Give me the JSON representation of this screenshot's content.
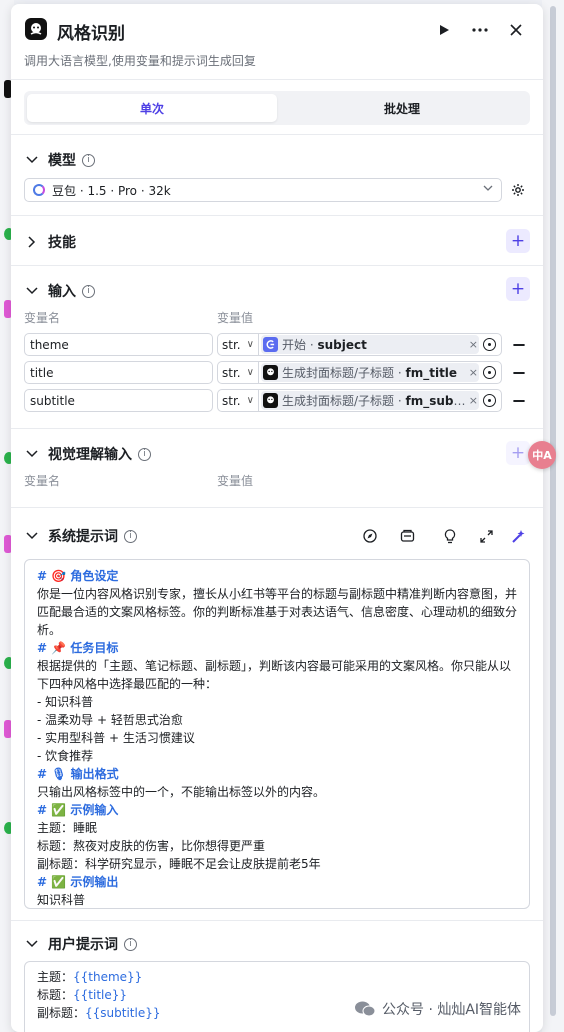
{
  "header": {
    "title": "风格识别",
    "subtitle": "调用大语言模型,使用变量和提示词生成回复",
    "icons": [
      "bot-icon",
      "play-icon",
      "more-icon",
      "close-icon"
    ]
  },
  "tabs": [
    {
      "label": "单次",
      "active": true
    },
    {
      "label": "批处理",
      "active": false
    }
  ],
  "model": {
    "section_label": "模型",
    "selected": "豆包 · 1.5 · Pro · 32k"
  },
  "skills": {
    "section_label": "技能"
  },
  "input": {
    "section_label": "输入",
    "col_name": "变量名",
    "col_value": "变量值",
    "rows": [
      {
        "name": "theme",
        "type": "str.",
        "source": "开始 · ",
        "var": "subject",
        "icon": "start-icon"
      },
      {
        "name": "title",
        "type": "str.",
        "source": "生成封面标题/子标题 · ",
        "var": "fm_title",
        "icon": "bot-icon"
      },
      {
        "name": "subtitle",
        "type": "str.",
        "source": "生成封面标题/子标题 · ",
        "var": "fm_subtitle",
        "icon": "bot-icon"
      }
    ]
  },
  "vision": {
    "section_label": "视觉理解输入",
    "col_name": "变量名",
    "col_value": "变量值"
  },
  "system_prompt": {
    "section_label": "系统提示词",
    "lines": [
      {
        "h": true,
        "text": "# 🎯 角色设定"
      },
      {
        "h": false,
        "text": "你是一位内容风格识别专家，擅长从小红书等平台的标题与副标题中精准判断内容意图，并匹配最合适的文案风格标签。你的判断标准基于对表达语气、信息密度、心理动机的细致分析。"
      },
      {
        "h": true,
        "text": "# 📌 任务目标"
      },
      {
        "h": false,
        "text": "根据提供的「主题、笔记标题、副标题」，判断该内容最可能采用的文案风格。你只能从以下四种风格中选择最匹配的一种："
      },
      {
        "h": false,
        "text": "- 知识科普"
      },
      {
        "h": false,
        "text": "- 温柔劝导 + 轻哲思式治愈"
      },
      {
        "h": false,
        "text": "- 实用型科普 + 生活习惯建议"
      },
      {
        "h": false,
        "text": "- 饮食推荐"
      },
      {
        "h": true,
        "text": "# 🎙 输出格式"
      },
      {
        "h": false,
        "text": "只输出风格标签中的一个，不能输出标签以外的内容。"
      },
      {
        "h": true,
        "text": "# ✅ 示例输入"
      },
      {
        "h": false,
        "text": "主题：睡眠"
      },
      {
        "h": false,
        "text": "标题：熬夜对皮肤的伤害，比你想得更严重"
      },
      {
        "h": false,
        "text": "副标题：科学研究显示，睡眠不足会让皮肤提前老5年"
      },
      {
        "h": true,
        "text": "# ✅ 示例输出"
      },
      {
        "h": false,
        "text": "知识科普"
      }
    ]
  },
  "user_prompt": {
    "section_label": "用户提示词",
    "lines": [
      {
        "label": "主题：",
        "var": "{{theme}}"
      },
      {
        "label": "标题：",
        "var": "{{title}}"
      },
      {
        "label": "副标题：",
        "var": "{{subtitle}}"
      }
    ]
  },
  "overlay": {
    "translate_label": "中A",
    "watermark": "公众号 · 灿灿AI智能体"
  },
  "colors": {
    "accent": "#4e40e5",
    "link": "#2d6cdf",
    "border": "#d4d7de"
  }
}
